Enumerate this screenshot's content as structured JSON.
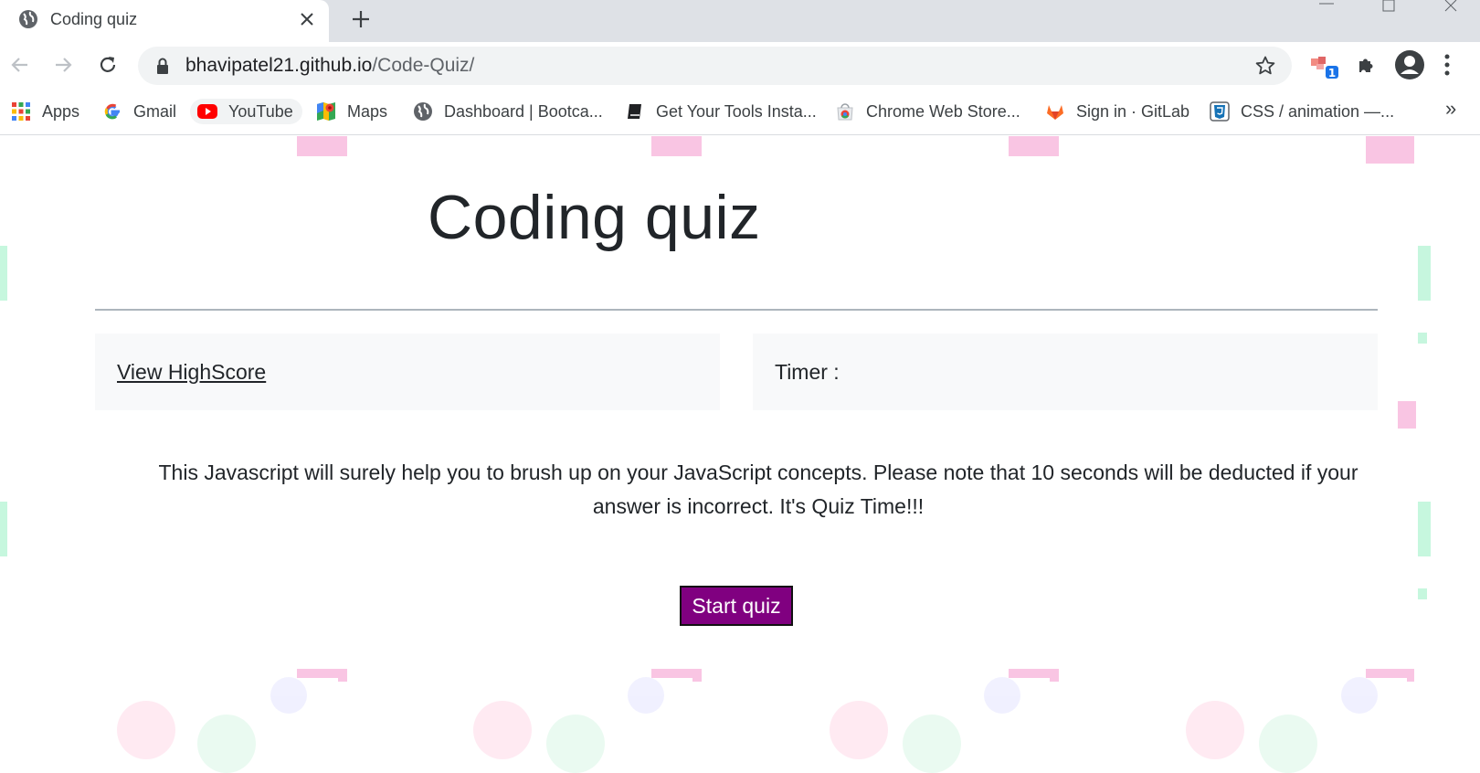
{
  "browser": {
    "tab": {
      "title": "Coding quiz"
    },
    "url": {
      "host": "bhavipatel21.github.io",
      "path": "/Code-Quiz/"
    },
    "extension_badge": "1",
    "bookmarks": [
      {
        "label": "Apps",
        "icon": "apps-grid-icon"
      },
      {
        "label": "Gmail",
        "icon": "google-icon"
      },
      {
        "label": "YouTube",
        "icon": "youtube-icon"
      },
      {
        "label": "Maps",
        "icon": "maps-icon"
      },
      {
        "label": "Dashboard | Bootca...",
        "icon": "globe-icon"
      },
      {
        "label": "Get Your Tools Insta...",
        "icon": "book-icon"
      },
      {
        "label": "Chrome Web Store...",
        "icon": "chrome-webstore-icon"
      },
      {
        "label": "Sign in · GitLab",
        "icon": "gitlab-icon"
      },
      {
        "label": "CSS / animation —...",
        "icon": "css-icon"
      }
    ],
    "overflow_label": "»"
  },
  "page": {
    "heading": "Coding quiz",
    "highscore_link": "View HighScore",
    "timer_label": "Timer :",
    "description": "This Javascript will surely help you to brush up on your JavaScript concepts. Please note that 10 seconds will be deducted if your answer is incorrect. It's Quiz Time!!!",
    "start_button": "Start quiz"
  },
  "colors": {
    "start_button_bg": "#800080",
    "card_bg": "#f8f9fa",
    "text": "#212529"
  }
}
